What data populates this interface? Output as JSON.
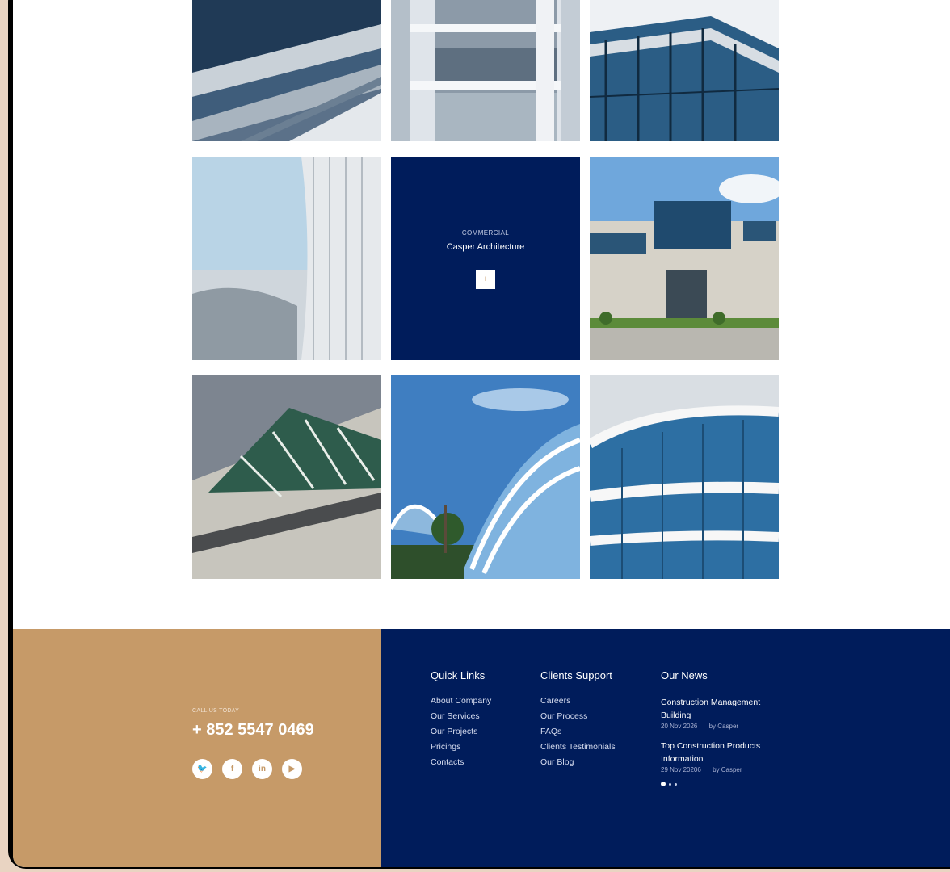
{
  "portfolio": {
    "tiles": [
      {
        "name": "tile-1",
        "icon": "building-photo"
      },
      {
        "name": "tile-2",
        "icon": "building-photo"
      },
      {
        "name": "tile-3",
        "icon": "building-photo"
      },
      {
        "name": "tile-4",
        "icon": "building-photo"
      },
      {
        "name": "tile-6",
        "icon": "building-photo"
      },
      {
        "name": "tile-7",
        "icon": "building-photo"
      },
      {
        "name": "tile-8",
        "icon": "building-photo"
      },
      {
        "name": "tile-9",
        "icon": "building-photo"
      }
    ],
    "featured": {
      "category": "COMMERCIAL",
      "title": "Casper Architecture",
      "button_label": "+"
    }
  },
  "footer": {
    "call_label": "CALL US TODAY",
    "phone": "+ 852 5547 0469",
    "socials": [
      {
        "icon": "twitter-icon",
        "glyph": "🐦"
      },
      {
        "icon": "facebook-icon",
        "glyph": "f"
      },
      {
        "icon": "linkedin-icon",
        "glyph": "in"
      },
      {
        "icon": "youtube-icon",
        "glyph": "▶"
      }
    ],
    "quick_links": {
      "title": "Quick Links",
      "items": [
        "About Company",
        "Our Services",
        "Our Projects",
        "Pricings",
        "Contacts"
      ]
    },
    "clients_support": {
      "title": "Clients Support",
      "items": [
        "Careers",
        "Our Process",
        "FAQs",
        "Clients Testimonials",
        "Our Blog"
      ]
    },
    "news": {
      "title": "Our News",
      "items": [
        {
          "title": "Construction Management Building",
          "date": "20 Nov 2026",
          "author": "by Casper"
        },
        {
          "title": "Top Construction Products Information",
          "date": "29 Nov 20206",
          "author": "by Casper"
        }
      ]
    },
    "colors": {
      "tan": "#c69a68",
      "navy": "#001c5b"
    }
  }
}
